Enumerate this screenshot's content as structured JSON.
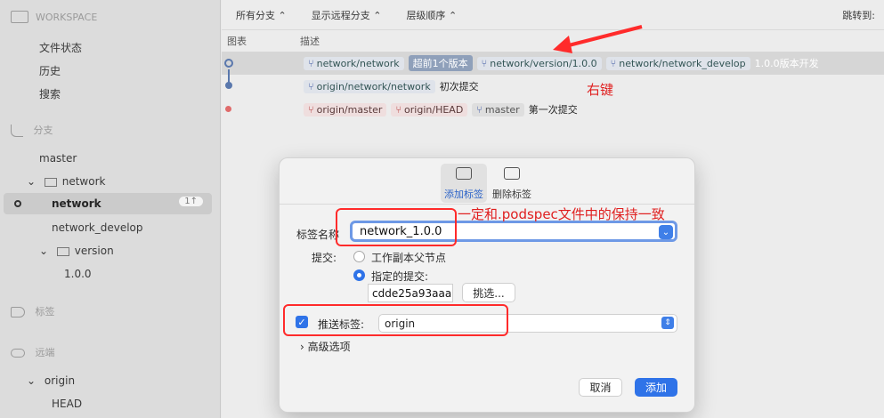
{
  "sidebar": {
    "workspace_title": "WORKSPACE",
    "items": [
      {
        "label": "文件状态"
      },
      {
        "label": "历史"
      },
      {
        "label": "搜索"
      }
    ],
    "branches_title": "分支",
    "branches": {
      "master": "master",
      "network_folder": "network",
      "network_branch": "network",
      "network_badge": "1↑",
      "network_develop": "network_develop",
      "version_folder": "version",
      "version_tag": "1.0.0"
    },
    "tags_title": "标签",
    "remotes_title": "远端",
    "origin": "origin",
    "head": "HEAD"
  },
  "toolbar": {
    "all_branches": "所有分支",
    "show_remote": "显示远程分支",
    "order": "层级顺序",
    "jump": "跳转到:"
  },
  "columns": {
    "graph": "图表",
    "desc": "描述"
  },
  "rows": [
    {
      "tags": [
        "network/network",
        "超前1个版本",
        "network/version/1.0.0",
        "network/network_develop"
      ],
      "msg": "1.0.0版本开发"
    },
    {
      "tags": [
        "origin/network/network"
      ],
      "msg": "初次提交"
    },
    {
      "tags": [
        "origin/master",
        "origin/HEAD",
        "master"
      ],
      "msg": "第一次提交"
    }
  ],
  "annotations": {
    "right_key": "右键",
    "keep_consistent": "一定和.podspec文件中的保持一致"
  },
  "dialog": {
    "tab_add": "添加标签",
    "tab_delete": "删除标签",
    "tag_name_label": "标签名称",
    "tag_name_value": "network_1.0.0",
    "commit_label": "提交:",
    "radio_parent": "工作副本父节点",
    "radio_specified": "指定的提交:",
    "commit_hash": "cdde25a93aaa",
    "choose_btn": "挑选...",
    "push_label": "推送标签:",
    "push_remote": "origin",
    "advanced": "高级选项",
    "cancel": "取消",
    "add": "添加"
  },
  "colors": {
    "accent": "#2f73e8",
    "annotation": "#ff2b2b"
  }
}
